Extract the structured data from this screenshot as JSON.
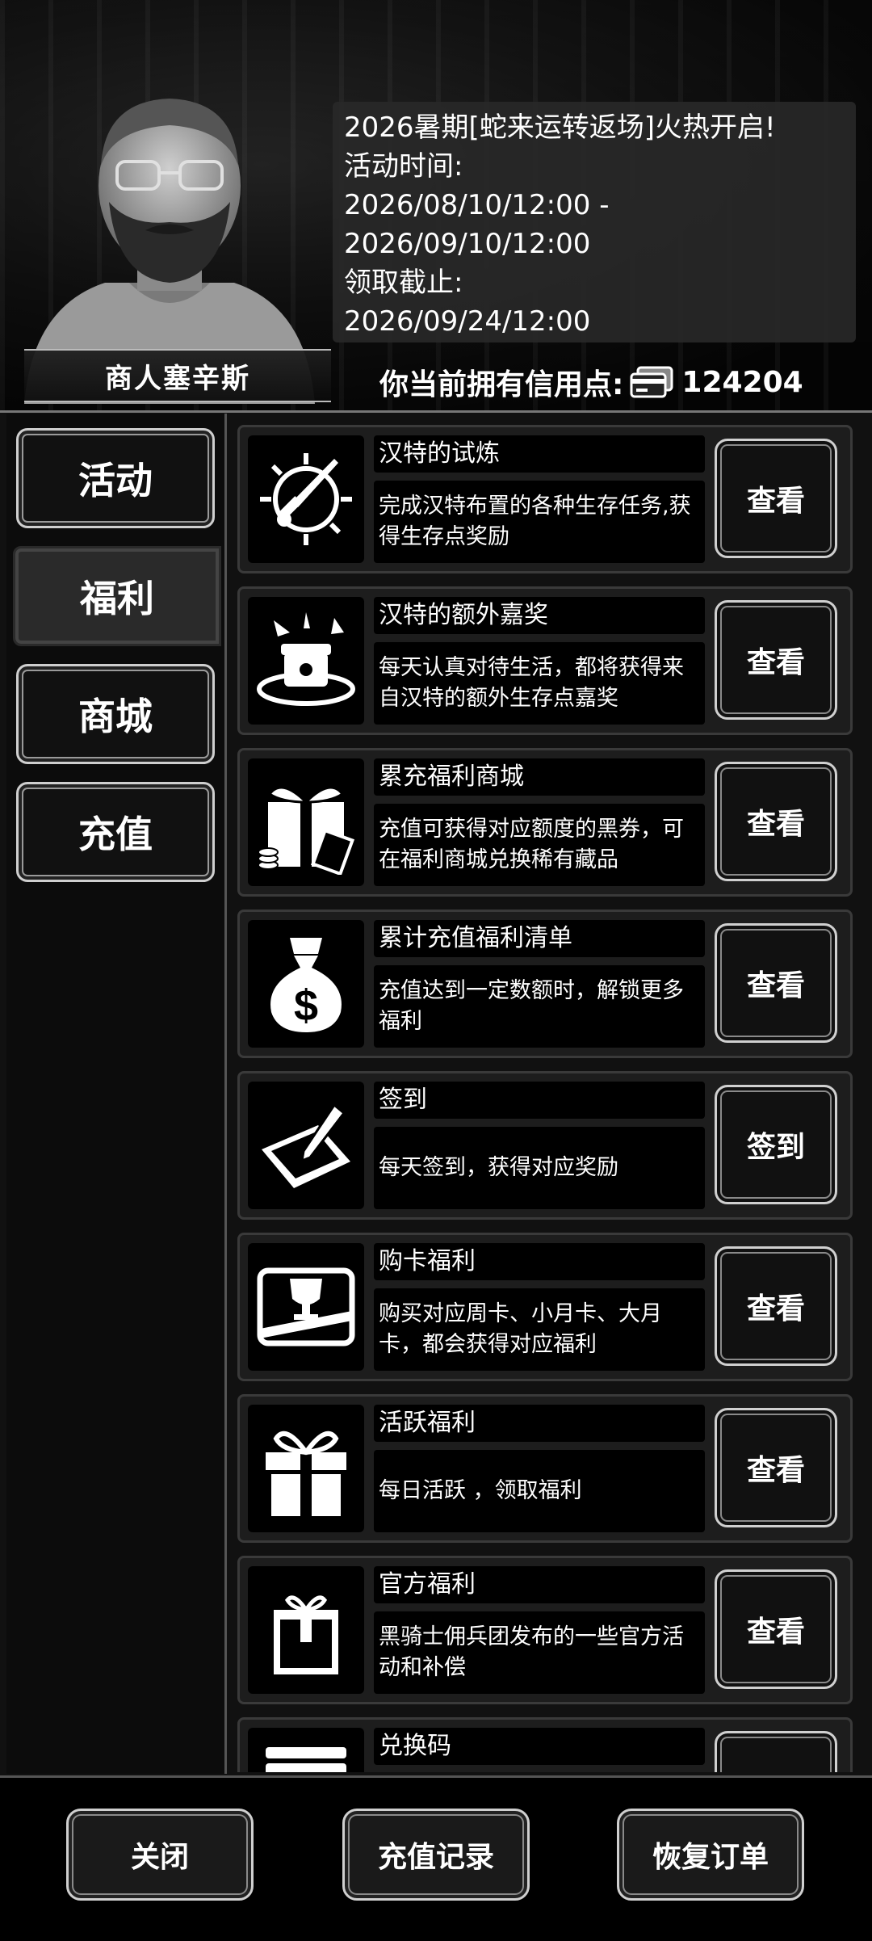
{
  "header": {
    "merchant_name": "商人塞辛斯",
    "announcement": [
      "2026暑期[蛇来运转返场]火热开启!",
      "活动时间:",
      "2026/08/10/12:00 -",
      "2026/09/10/12:00",
      "领取截止:",
      "2026/09/24/12:00"
    ],
    "credits_label": "你当前拥有信用点:",
    "credits_value": "124204"
  },
  "nav": {
    "items": [
      {
        "label": "活动",
        "active": false
      },
      {
        "label": "福利",
        "active": true
      },
      {
        "label": "商城",
        "active": false
      },
      {
        "label": "充值",
        "active": false
      }
    ]
  },
  "list": {
    "items": [
      {
        "icon": "sword-sun-icon",
        "title": "汉特的试炼",
        "desc": "完成汉特布置的各种生存任务,获得生存点奖励",
        "action": "查看"
      },
      {
        "icon": "treasure-chest-icon",
        "title": "汉特的额外嘉奖",
        "desc": "每天认真对待生活，都将获得来自汉特的额外生存点嘉奖",
        "action": "查看"
      },
      {
        "icon": "gift-coins-icon",
        "title": "累充福利商城",
        "desc": "充值可获得对应额度的黑券，可在福利商城兑换稀有藏品",
        "action": "查看"
      },
      {
        "icon": "money-bag-icon",
        "title": "累计充值福利清单",
        "desc": "充值达到一定数额时，解锁更多福利",
        "action": "查看"
      },
      {
        "icon": "tablet-pen-icon",
        "title": "签到",
        "desc": "每天签到，获得对应奖励",
        "action": "签到"
      },
      {
        "icon": "trophy-card-icon",
        "title": "购卡福利",
        "desc": "购买对应周卡、小月卡、大月卡，都会获得对应福利",
        "action": "查看"
      },
      {
        "icon": "gift-box-icon",
        "title": "活跃福利",
        "desc": "每日活跃 ，领取福利",
        "action": "查看"
      },
      {
        "icon": "package-icon",
        "title": "官方福利",
        "desc": "黑骑士佣兵团发布的一些官方活动和补偿",
        "action": "查看"
      },
      {
        "icon": "stack-icon",
        "title": "兑换码",
        "desc": "",
        "action": ""
      }
    ]
  },
  "footer": {
    "close_label": "关闭",
    "history_label": "充值记录",
    "restore_label": "恢复订单"
  }
}
